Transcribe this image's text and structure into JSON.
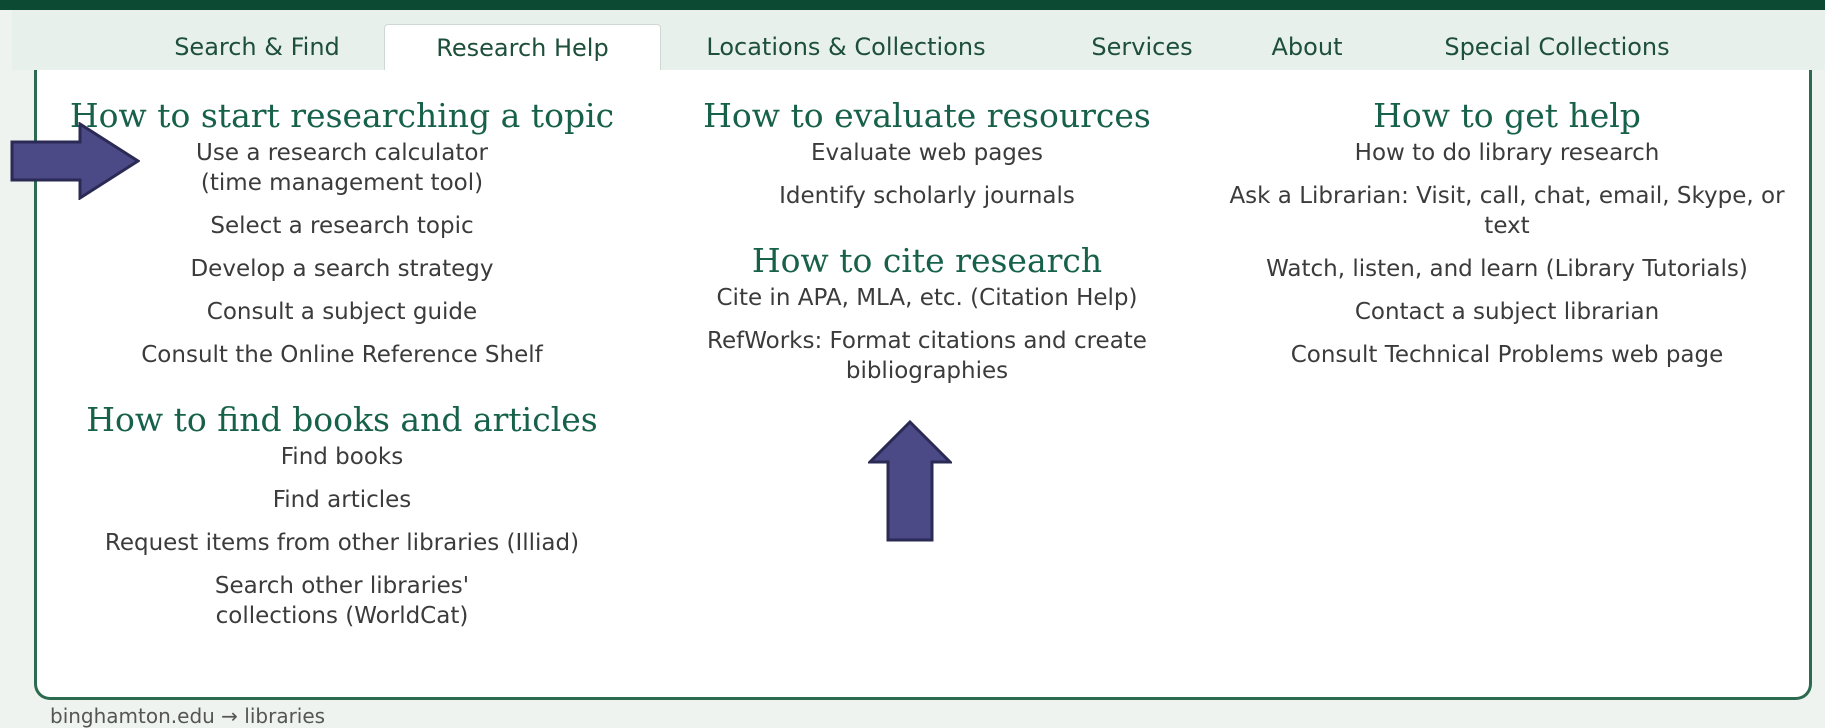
{
  "nav": {
    "items": [
      {
        "label": "Search & Find"
      },
      {
        "label": "Research Help"
      },
      {
        "label": "Locations & Collections"
      },
      {
        "label": "Services"
      },
      {
        "label": "About"
      },
      {
        "label": "Special Collections"
      }
    ],
    "active": "Research Help"
  },
  "columns": [
    {
      "sections": [
        {
          "heading": "How to start researching a topic",
          "links": [
            "Use a research calculator (time management tool)",
            "Select a research topic",
            "Develop a search strategy",
            "Consult a subject guide",
            "Consult the Online Reference Shelf"
          ]
        },
        {
          "heading": "How to find books and articles",
          "links": [
            "Find books",
            "Find articles",
            "Request items from other libraries (Illiad)",
            "Search other libraries' collections (WorldCat)"
          ]
        }
      ]
    },
    {
      "sections": [
        {
          "heading": "How to evaluate resources",
          "links": [
            "Evaluate web pages",
            "Identify scholarly journals"
          ]
        },
        {
          "heading": "How to cite research",
          "links": [
            "Cite in APA, MLA, etc. (Citation Help)",
            "RefWorks:  Format citations and create bibliographies"
          ]
        }
      ]
    },
    {
      "sections": [
        {
          "heading": "How to get help",
          "links": [
            "How to do library research",
            "Ask a Librarian:  Visit, call, chat, email, Skype, or text",
            "Watch, listen, and learn (Library Tutorials)",
            "Contact a subject librarian",
            "Consult Technical Problems web page"
          ]
        }
      ]
    }
  ],
  "breadcrumb": "binghamton.edu → libraries",
  "colors": {
    "brand_dark": "#0d4a33",
    "heading": "#17614a",
    "annotation_arrow": "#4b4a86"
  }
}
